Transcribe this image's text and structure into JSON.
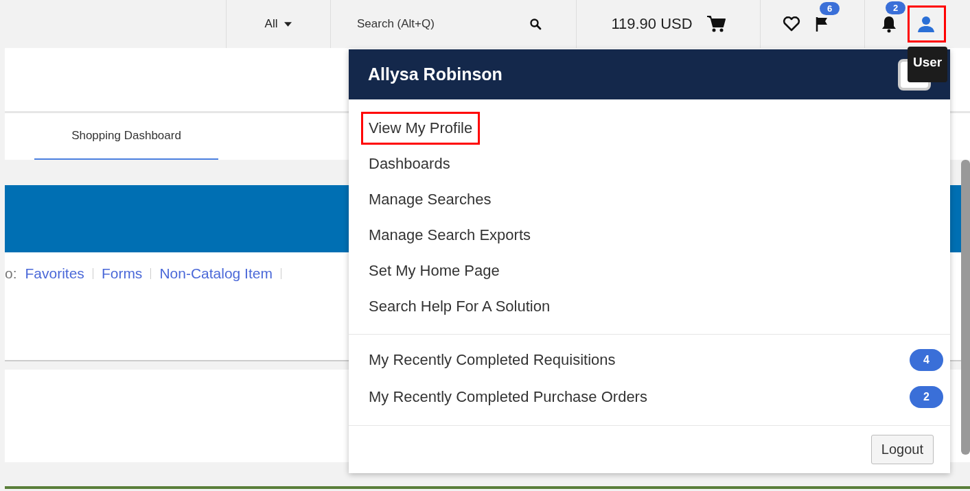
{
  "topbar": {
    "scope": "All",
    "search": {
      "placeholder": "Search (Alt+Q)"
    },
    "cart_total": "119.90 USD",
    "flag_count": "6",
    "notification_count": "2",
    "user_highlighted": true
  },
  "tabs": [
    {
      "label": "Shopping Dashboard",
      "selected": true
    }
  ],
  "quick_links": {
    "prefix": "o:",
    "links": [
      "Favorites",
      "Forms",
      "Non-Catalog Item"
    ]
  },
  "user_menu": {
    "name": "Allysa Robinson",
    "items": [
      {
        "label": "View My Profile",
        "highlighted": true
      },
      {
        "label": "Dashboards",
        "highlighted": false
      },
      {
        "label": "Manage Searches",
        "highlighted": false
      },
      {
        "label": "Manage Search Exports",
        "highlighted": false
      },
      {
        "label": "Set My Home Page",
        "highlighted": false
      },
      {
        "label": "Search Help For A Solution",
        "highlighted": false
      }
    ],
    "recent": [
      {
        "label": "My Recently Completed Requisitions",
        "count": "4"
      },
      {
        "label": "My Recently Completed Purchase Orders",
        "count": "2"
      }
    ],
    "logout": "Logout"
  },
  "tooltip": "User"
}
